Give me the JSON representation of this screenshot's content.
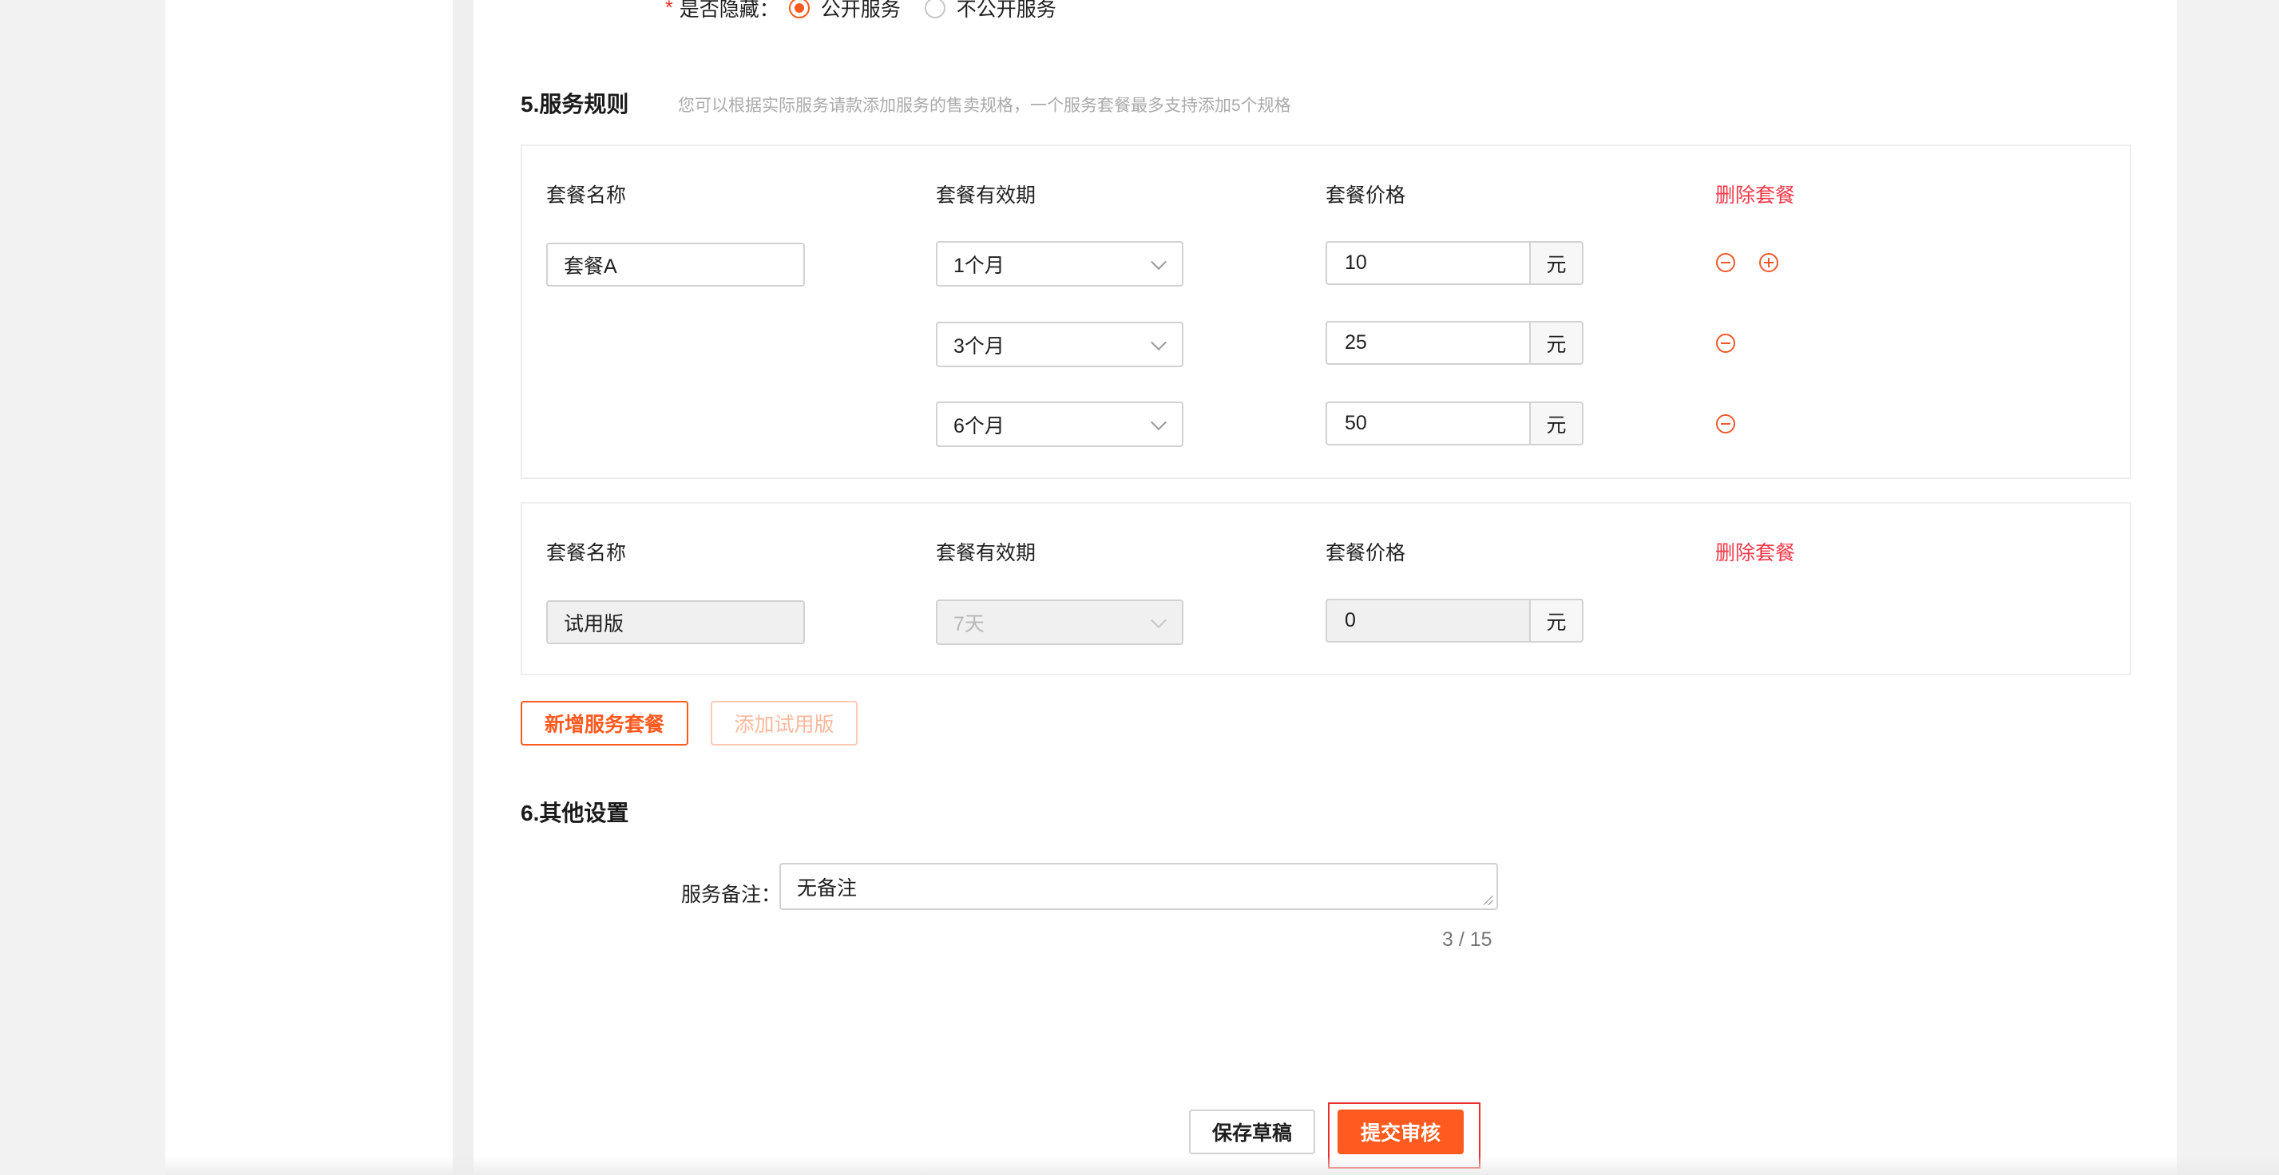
{
  "visibility": {
    "required_mark": "*",
    "label": "是否隐藏：",
    "options": [
      {
        "label": "公开服务",
        "checked": true
      },
      {
        "label": "不公开服务",
        "checked": false
      }
    ]
  },
  "rules": {
    "title": "5.服务规则",
    "hint": "您可以根据实际服务请款添加服务的售卖规格，一个服务套餐最多支持添加5个规格",
    "packages": [
      {
        "headers": {
          "name": "套餐名称",
          "period": "套餐有效期",
          "price": "套餐价格",
          "delete": "删除套餐"
        },
        "name": "套餐A",
        "rows": [
          {
            "period": "1个月",
            "price": "10",
            "unit": "元"
          },
          {
            "period": "3个月",
            "price": "25",
            "unit": "元"
          },
          {
            "period": "6个月",
            "price": "50",
            "unit": "元"
          }
        ]
      },
      {
        "headers": {
          "name": "套餐名称",
          "period": "套餐有效期",
          "price": "套餐价格",
          "delete": "删除套餐"
        },
        "name": "试用版",
        "rows": [
          {
            "period": "7天",
            "price": "0",
            "unit": "元"
          }
        ]
      }
    ],
    "add_package_label": "新增服务套餐",
    "add_trial_label": "添加试用版"
  },
  "other": {
    "title": "6.其他设置",
    "remark_label": "服务备注：",
    "remark_value": "无备注",
    "counter": "3 / 15"
  },
  "footer": {
    "save_draft": "保存草稿",
    "submit": "提交审核"
  },
  "colors": {
    "accent": "#ff5a1f",
    "danger": "#f2394a"
  }
}
